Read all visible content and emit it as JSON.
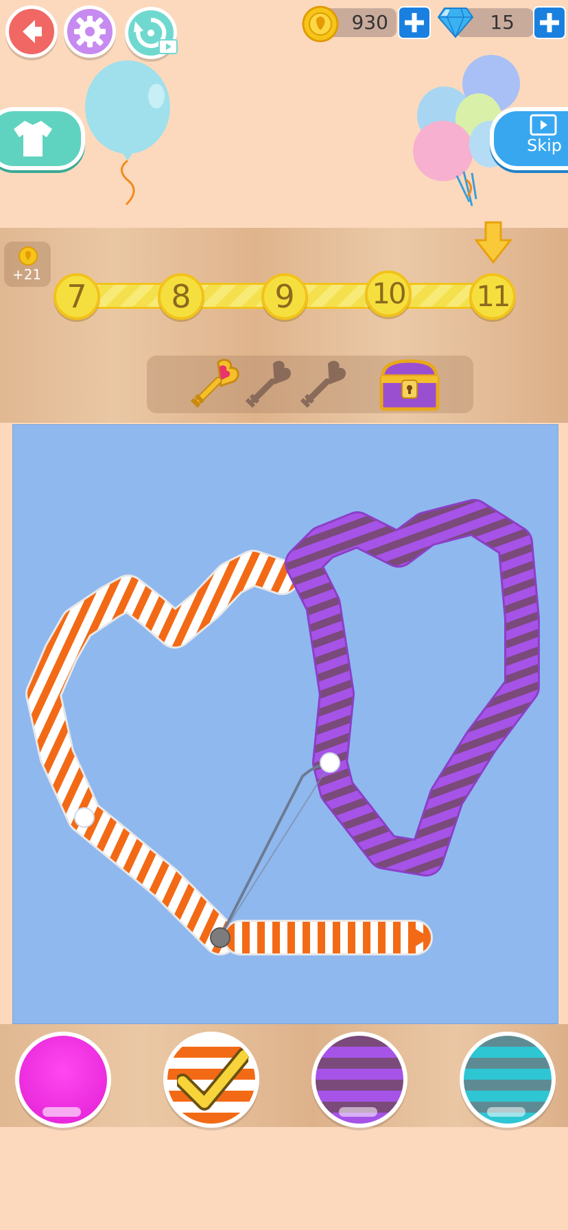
{
  "hud": {
    "coins": "930",
    "gems": "15",
    "skip_label": "Skip",
    "reward_label": "+21"
  },
  "level_track": {
    "levels": [
      "7",
      "8",
      "9",
      "10",
      "11"
    ],
    "current_level": "11"
  },
  "keys": {
    "collected": 1,
    "total": 3
  },
  "palette": {
    "options": [
      "magenta",
      "orange-stripe",
      "purple-stripe",
      "teal-stripe"
    ],
    "selected": "orange-stripe"
  },
  "colors": {
    "background": "#fcd9bd",
    "board": "#8fb8ee",
    "orange": "#f36a16",
    "purple": "#9c4fe3",
    "magenta": "#f533e6",
    "teal": "#2fc6d4",
    "coin": "#f5c518",
    "gem": "#3ab2f2"
  }
}
